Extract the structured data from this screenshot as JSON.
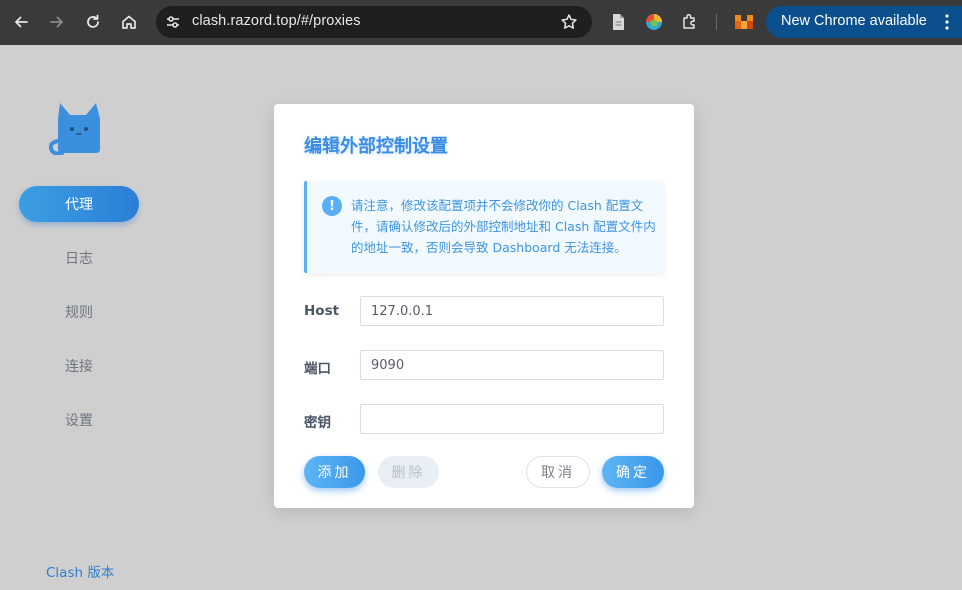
{
  "browser": {
    "url": "clash.razord.top/#/proxies",
    "update_label": "New Chrome available"
  },
  "sidebar": {
    "items": [
      {
        "label": "代理",
        "active": true
      },
      {
        "label": "日志",
        "active": false
      },
      {
        "label": "规则",
        "active": false
      },
      {
        "label": "连接",
        "active": false
      },
      {
        "label": "设置",
        "active": false
      }
    ],
    "version_label": "Clash 版本"
  },
  "dialog": {
    "title": "编辑外部控制设置",
    "alert": "请注意，修改该配置项并不会修改你的 Clash 配置文件，请确认修改后的外部控制地址和 Clash 配置文件内的地址一致，否则会导致 Dashboard 无法连接。",
    "fields": {
      "host": {
        "label": "Host",
        "value": "127.0.0.1"
      },
      "port": {
        "label": "端口",
        "value": "9090"
      },
      "secret": {
        "label": "密钥",
        "value": ""
      }
    },
    "buttons": {
      "add": "添加",
      "delete": "删除",
      "cancel": "取消",
      "confirm": "确定"
    }
  },
  "colors": {
    "accent": "#3a8de6",
    "toolbar": "#3a3a3a",
    "update_button": "#0b4f8c",
    "page_dim": "#cfcfcf"
  }
}
